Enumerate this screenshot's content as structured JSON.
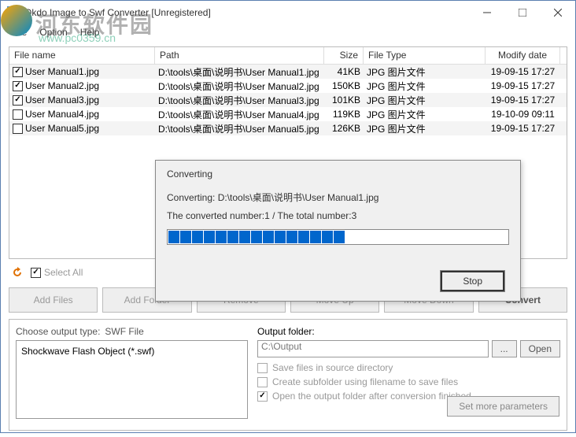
{
  "window": {
    "title": "Okdo Image to Swf Converter [Unregistered]"
  },
  "menu": {
    "file": "File",
    "option": "Option",
    "help": "Help"
  },
  "watermark": {
    "text1": "河东软件园",
    "text2": "www.pc0359.cn"
  },
  "headers": {
    "name": "File name",
    "path": "Path",
    "size": "Size",
    "type": "File Type",
    "date": "Modify date"
  },
  "files": [
    {
      "checked": true,
      "name": "User Manual1.jpg",
      "path": "D:\\tools\\桌面\\说明书\\User Manual1.jpg",
      "size": "41KB",
      "type": "JPG 图片文件",
      "date": "19-09-15 17:27"
    },
    {
      "checked": true,
      "name": "User Manual2.jpg",
      "path": "D:\\tools\\桌面\\说明书\\User Manual2.jpg",
      "size": "150KB",
      "type": "JPG 图片文件",
      "date": "19-09-15 17:27"
    },
    {
      "checked": true,
      "name": "User Manual3.jpg",
      "path": "D:\\tools\\桌面\\说明书\\User Manual3.jpg",
      "size": "101KB",
      "type": "JPG 图片文件",
      "date": "19-09-15 17:27"
    },
    {
      "checked": false,
      "name": "User Manual4.jpg",
      "path": "D:\\tools\\桌面\\说明书\\User Manual4.jpg",
      "size": "119KB",
      "type": "JPG 图片文件",
      "date": "19-10-09 09:11"
    },
    {
      "checked": false,
      "name": "User Manual5.jpg",
      "path": "D:\\tools\\桌面\\说明书\\User Manual5.jpg",
      "size": "126KB",
      "type": "JPG 图片文件",
      "date": "19-09-15 17:27"
    }
  ],
  "toolbar": {
    "select_all": "Select All",
    "add_files": "Add Files",
    "add_folder": "Add Folder",
    "remove": "Remove",
    "move_up": "Move Up",
    "move_down": "Move Down",
    "convert": "Convert"
  },
  "output": {
    "choose_label": "Choose output type:",
    "swf_label": "SWF File",
    "swf_option": "Shockwave Flash Object (*.swf)",
    "folder_label": "Output folder:",
    "folder_value": "C:\\Output",
    "browse": "...",
    "open": "Open",
    "opt1": "Save files in source directory",
    "opt2": "Create subfolder using filename to save files",
    "opt3": "Open the output folder after conversion finished",
    "set_more": "Set more parameters"
  },
  "dialog": {
    "title": "Converting",
    "line1": "Converting:  D:\\tools\\桌面\\说明书\\User Manual1.jpg",
    "line2": "The converted number:1  / The total number:3",
    "stop": "Stop"
  }
}
